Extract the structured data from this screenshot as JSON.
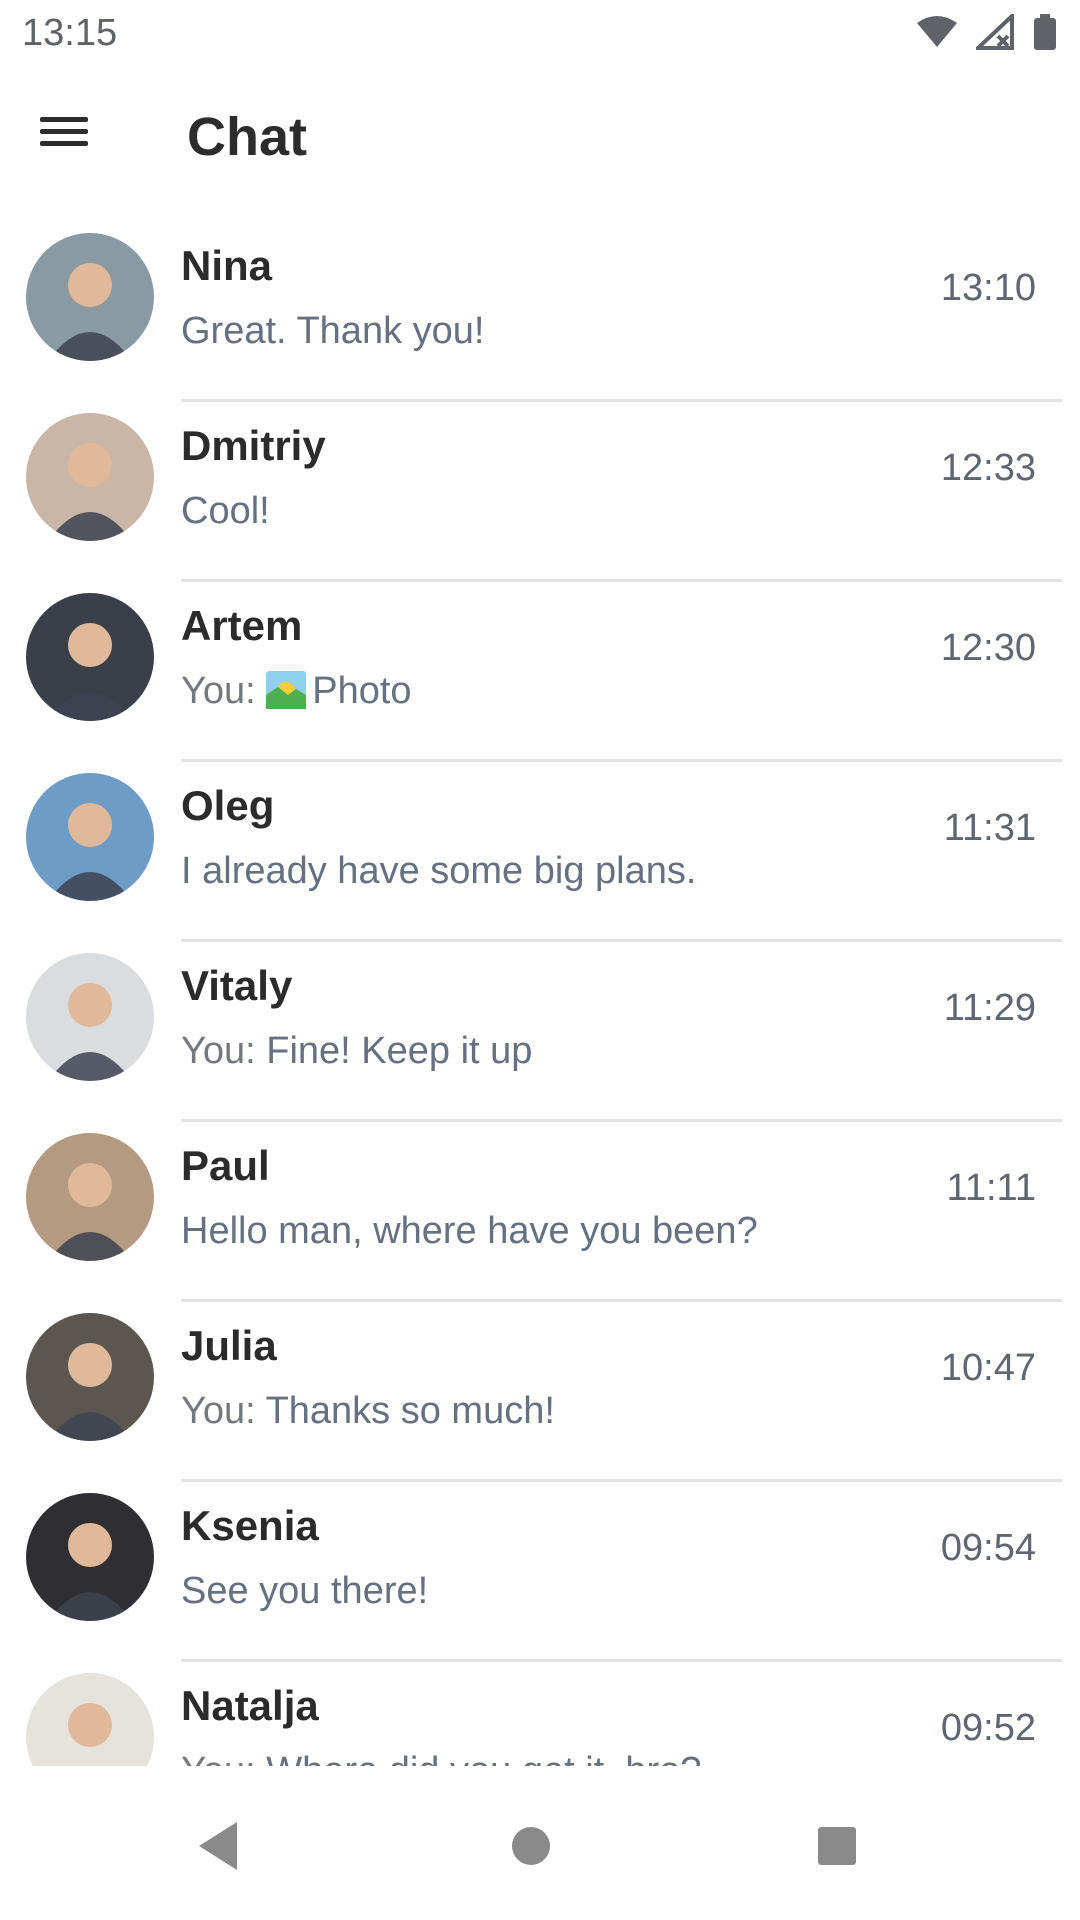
{
  "status_bar": {
    "time": "13:15"
  },
  "header": {
    "title": "Chat"
  },
  "chats": [
    {
      "name": "Nina",
      "prefix": "",
      "message": "Great. Thank you!",
      "time": "13:10",
      "avatar_color": "#8a9aa3"
    },
    {
      "name": "Dmitriy",
      "prefix": "",
      "message": "Cool!",
      "time": "12:33",
      "avatar_color": "#c9b6a6"
    },
    {
      "name": "Artem",
      "prefix": "You: ",
      "message": "Photo",
      "attachment_icon": "sunrise-photo-icon",
      "time": "12:30",
      "avatar_color": "#3a3f4a"
    },
    {
      "name": "Oleg",
      "prefix": "",
      "message": "I already have some big plans.",
      "time": "11:31",
      "avatar_color": "#6d9cc7"
    },
    {
      "name": "Vitaly",
      "prefix": "You: ",
      "message": "Fine! Keep it up",
      "time": "11:29",
      "avatar_color": "#d9dde0"
    },
    {
      "name": "Paul",
      "prefix": "",
      "message": "Hello man, where have you been?",
      "time": "11:11",
      "avatar_color": "#b49a80"
    },
    {
      "name": "Julia",
      "prefix": "You: ",
      "message": "Thanks so much!",
      "time": "10:47",
      "avatar_color": "#5b5750"
    },
    {
      "name": "Ksenia",
      "prefix": "",
      "message": "See you there!",
      "time": "09:54",
      "avatar_color": "#2f2f33"
    },
    {
      "name": "Natalja",
      "prefix": "You: ",
      "message": "Where did you get it, bro?",
      "time": "09:52",
      "avatar_color": "#e6e2dc"
    }
  ],
  "nav": {
    "back_icon": "back-triangle-icon",
    "home_icon": "home-circle-icon",
    "recents_icon": "recents-square-icon"
  },
  "colors": {
    "name": "#2b2b2b",
    "message": "#66707f",
    "time": "#5f6670",
    "divider": "#e3e3e3"
  }
}
